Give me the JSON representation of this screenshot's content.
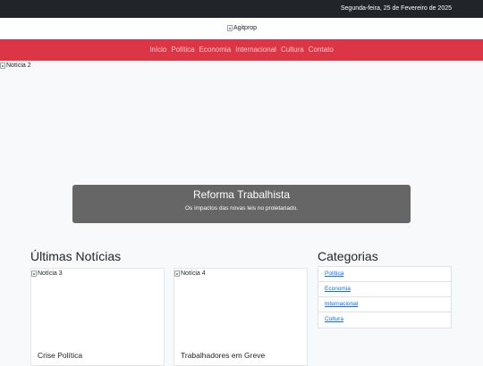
{
  "topbar": {
    "date": "Segunda-feira, 25 de Fevereiro de 2025"
  },
  "brand": {
    "logo_alt": "Agitprop"
  },
  "nav": {
    "items": [
      "Início",
      "Política",
      "Economia",
      "Internacional",
      "Cultura",
      "Contato"
    ]
  },
  "hero": {
    "image_alt": "Notícia 2",
    "caption_title": "Reforma Trabalhista",
    "caption_text": "Os impactos das novas leis no proletariado."
  },
  "news": {
    "heading": "Últimas Notícias",
    "cards": [
      {
        "image_alt": "Notícia 3",
        "title": "Crise Política"
      },
      {
        "image_alt": "Notícia 4",
        "title": "Trabalhadores em Greve"
      }
    ]
  },
  "categories": {
    "heading": "Categorias",
    "items": [
      "Política",
      "Economia",
      "Internacional",
      "Cultura"
    ]
  },
  "colors": {
    "topbar": "#212529",
    "navbar": "#dc3545",
    "link": "#0d6efd"
  },
  "icons": {
    "broken_image": "broken-image-icon"
  }
}
